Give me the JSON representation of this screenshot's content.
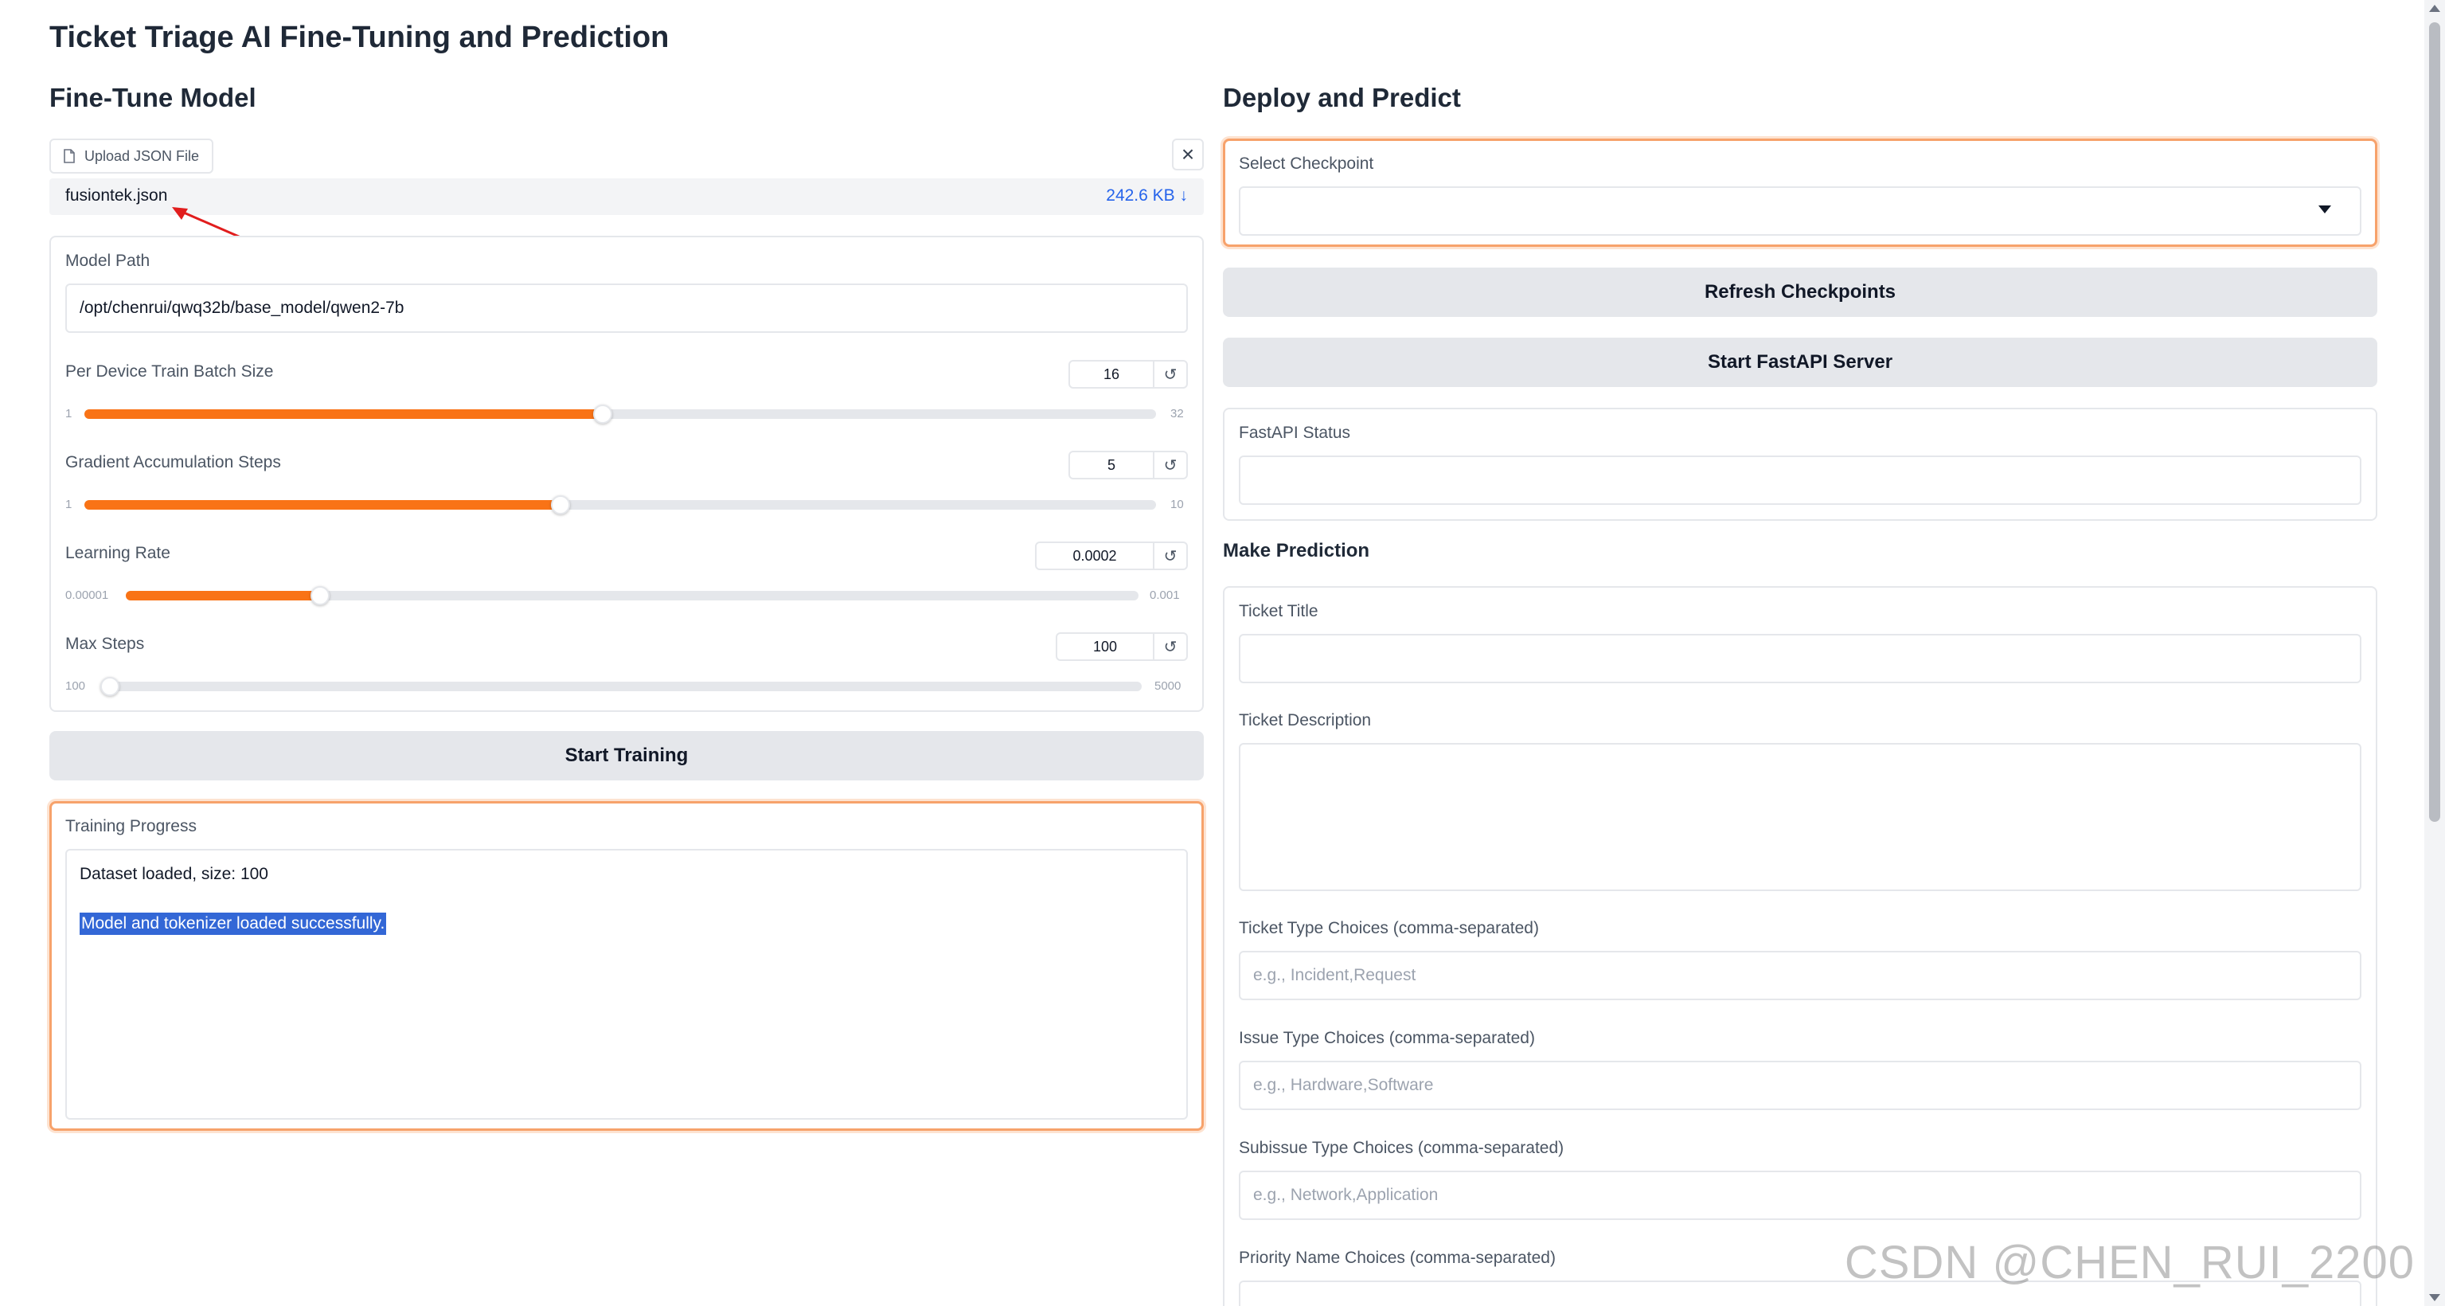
{
  "app": {
    "title": "Ticket Triage AI Fine-Tuning and Prediction"
  },
  "finetune": {
    "section_title": "Fine-Tune Model",
    "upload": {
      "tab_label": "Upload JSON File",
      "file_name": "fusiontek.json",
      "file_size": "242.6 KB ↓"
    },
    "model_path": {
      "label": "Model Path",
      "value": "/opt/chenrui/qwq32b/base_model/qwen2-7b"
    },
    "batch_size": {
      "label": "Per Device Train Batch Size",
      "value": "16",
      "min": "1",
      "max": "32",
      "fraction": 0.484
    },
    "grad_accum": {
      "label": "Gradient Accumulation Steps",
      "value": "5",
      "min": "1",
      "max": "10",
      "fraction": 0.444
    },
    "learning_rate": {
      "label": "Learning Rate",
      "value": "0.0002",
      "min": "0.00001",
      "max": "0.001",
      "fraction": 0.192
    },
    "max_steps": {
      "label": "Max Steps",
      "value": "100",
      "min": "100",
      "max": "5000",
      "fraction": 0.0
    },
    "start_button": "Start Training",
    "progress": {
      "label": "Training Progress",
      "lines": [
        "Dataset loaded, size: 100",
        "Model and tokenizer loaded successfully."
      ]
    }
  },
  "deploy": {
    "section_title": "Deploy and Predict",
    "checkpoint": {
      "label": "Select Checkpoint",
      "value": ""
    },
    "refresh_button": "Refresh Checkpoints",
    "server_button": "Start FastAPI Server",
    "status": {
      "label": "FastAPI Status",
      "value": ""
    },
    "prediction_title": "Make Prediction",
    "ticket_title": {
      "label": "Ticket Title",
      "value": ""
    },
    "ticket_description": {
      "label": "Ticket Description",
      "value": ""
    },
    "ticket_type": {
      "label": "Ticket Type Choices (comma-separated)",
      "placeholder": "e.g., Incident,Request"
    },
    "issue_type": {
      "label": "Issue Type Choices (comma-separated)",
      "placeholder": "e.g., Hardware,Software"
    },
    "subissue_type": {
      "label": "Subissue Type Choices (comma-separated)",
      "placeholder": "e.g., Network,Application"
    },
    "priority": {
      "label": "Priority Name Choices (comma-separated)"
    }
  },
  "watermark": "CSDN @CHEN_RUI_2200",
  "colors": {
    "accent": "#f97316",
    "focus_border": "#f7a26b",
    "link": "#2563eb",
    "selection": "#3367d6"
  },
  "icons": {
    "file": "file-icon",
    "close": "close-icon",
    "reset": "reset-icon",
    "dropdown": "chevron-down-icon"
  }
}
